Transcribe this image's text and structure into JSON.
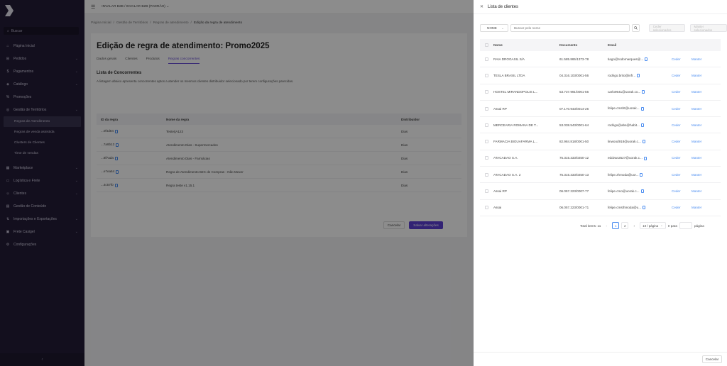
{
  "sidebar": {
    "search_label": "Buscar",
    "items": [
      {
        "label": "Página Inicial",
        "icon": "home-icon",
        "chevron": false
      },
      {
        "label": "Pedidos",
        "icon": "cart-icon",
        "chevron": true
      },
      {
        "label": "Pagamentos",
        "icon": "dollar-icon",
        "chevron": true
      },
      {
        "label": "Catálogo",
        "icon": "tag-icon",
        "chevron": true
      },
      {
        "label": "Promoções",
        "icon": "percent-icon",
        "chevron": false
      },
      {
        "label": "Gestão de Territórios",
        "icon": "territory-icon",
        "chevron": true
      }
    ],
    "subitems": [
      {
        "label": "Regras de Atendimento",
        "active": true
      },
      {
        "label": "Regras de venda assistida",
        "active": false
      },
      {
        "label": "Clusters de Clientes",
        "active": false
      },
      {
        "label": "Time de vendas",
        "active": false
      }
    ],
    "items_after": [
      {
        "label": "Marketplace",
        "icon": "store-icon",
        "chevron": true
      },
      {
        "label": "Logística e Frete",
        "icon": "truck-icon",
        "chevron": true
      },
      {
        "label": "Clientes",
        "icon": "users-icon",
        "chevron": true
      },
      {
        "label": "Gestão de Conteúdo",
        "icon": "content-icon",
        "chevron": false
      },
      {
        "label": "Importações e Exportações",
        "icon": "import-export-icon",
        "chevron": true
      },
      {
        "label": "Frete Casigel",
        "icon": "freight-icon",
        "chevron": true
      },
      {
        "label": "Configurações",
        "icon": "gear-icon",
        "chevron": false
      }
    ]
  },
  "topbar": {
    "store": "INVALAR B2B / INVALAR B2B (PADRÃO)"
  },
  "breadcrumb": [
    "Página Inicial",
    "Gestão de Territórios",
    "Regras de atendimento",
    "Edição da regra de atendimento"
  ],
  "main": {
    "title": "Edição de regra de atendimento: Promo2025",
    "tabs": [
      {
        "label": "Dados gerais",
        "active": false
      },
      {
        "label": "Clientes",
        "active": false
      },
      {
        "label": "Produtos",
        "active": false
      },
      {
        "label": "Regras concorrentes",
        "active": true
      }
    ],
    "section_title": "Lista de Concorrentes",
    "section_desc": "A listagem abaixo apresenta concorrentes aptos a atender os mesmos clientes distribuidor selecionado por terem configurações parecidas.",
    "columns": [
      "ID da regra",
      "Nome da regra",
      "Distribuidor"
    ],
    "rows": [
      {
        "id": "...0f4d84",
        "nome": "Teste/jA123",
        "dist": "Dias"
      },
      {
        "id": "...7a8b13",
        "nome": "Atendimento Dias - Supermercados",
        "dist": "Dias"
      },
      {
        "id": "...8f7ada",
        "nome": "Atendimento Dias - Farmácias",
        "dist": "Dias"
      },
      {
        "id": "...e7ea64",
        "nome": "Regra de Atendimento B2C de Compras - Não Mexer",
        "dist": "Dias"
      },
      {
        "id": "...4c57f0",
        "nome": "Regra teste v1.15.1",
        "dist": "Dias"
      }
    ],
    "cancel_label": "Cancelar",
    "save_label": "Salvar alterações"
  },
  "drawer": {
    "title": "Lista de clientes",
    "filter_select": "NOME",
    "search_placeholder": "Buscar pelo nome",
    "btn_ceder": "Ceder selecionados",
    "btn_manter": "Manter selecionados",
    "columns": [
      "Nome",
      "Documento",
      "Email"
    ],
    "rows": [
      {
        "nome": "RAIA DROGASIL S/A",
        "doc": "61.585.865/1373-78",
        "email": "tiago@rodomarques@...",
        "ceder": "Ceder",
        "manter": "Manter"
      },
      {
        "nome": "TESLA BRASIL LTDA",
        "doc": "04.316.103/0001-56",
        "email": "rodrigo.brito@infr...",
        "ceder": "Ceder",
        "manter": "Manter"
      },
      {
        "nome": "HOSTEL MIRANDOPOLIS L...",
        "doc": "53.737.991/0001-56",
        "email": "carlo9641@uorak.co...",
        "ceder": "Ceder",
        "manter": "Manter"
      },
      {
        "nome": "Assai RP",
        "doc": "07.170.943/0014-26",
        "email": "felipe.cmsht@uorak...",
        "ceder": "Ceder",
        "manter": "Manter"
      },
      {
        "nome": "MERCEARIA ROMANA DE T...",
        "doc": "53.038.543/0001-64",
        "email": "rodrigo@abs@habit...",
        "ceder": "Ceder",
        "manter": "Manter"
      },
      {
        "nome": "FARMACIA BIGUAFARMA L...",
        "doc": "82.984.818/0001-50",
        "email": "linwood918@uorak.c...",
        "ceder": "Ceder",
        "manter": "Manter"
      },
      {
        "nome": "ATACADAO S.A.",
        "doc": "75.315.333/0250-12",
        "email": "eddvan2527@uorak.c...",
        "ceder": "Ceder",
        "manter": "Manter"
      },
      {
        "nome": "ATACADAO S.A. 2",
        "doc": "75.315.333/0250-13",
        "email": "felipe.zhmoda@uor...",
        "ceder": "Ceder",
        "manter": "Manter"
      },
      {
        "nome": "Assai RP",
        "doc": "06.057.223/0007-77",
        "email": "felipe.cmo@uorak.c...",
        "ceder": "Ceder",
        "manter": "Manter"
      },
      {
        "nome": "Assai",
        "doc": "06.057.223/0001-71",
        "email": "felipe.cmsthmoda@u...",
        "ceder": "Ceder",
        "manter": "Manter"
      }
    ],
    "pager": {
      "total": "Total items: 11",
      "pages": [
        "1",
        "2"
      ],
      "page_size": "10 / página",
      "goto_label": "Ir para",
      "goto_suffix": "página"
    },
    "cancel_label": "Cancelar"
  }
}
